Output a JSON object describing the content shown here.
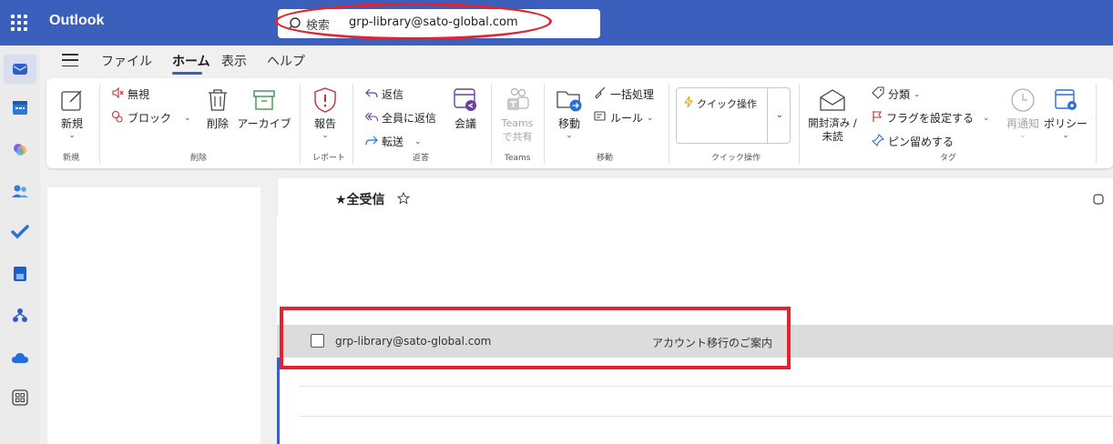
{
  "app": {
    "name": "Outlook"
  },
  "search": {
    "label": "検索",
    "value": "grp-library@sato-global.com"
  },
  "tabs": [
    {
      "label": "ファイル"
    },
    {
      "label": "ホーム"
    },
    {
      "label": "表示"
    },
    {
      "label": "ヘルプ"
    }
  ],
  "ribbon": {
    "new": {
      "label": "新規",
      "group": "新規"
    },
    "delete": {
      "ignore": "無視",
      "block": "ブロック",
      "delete": "削除",
      "archive": "アーカイブ",
      "group": "削除"
    },
    "report": {
      "label": "報告",
      "group": "レポート"
    },
    "respond": {
      "reply": "返信",
      "reply_all": "全員に返信",
      "forward": "転送",
      "meeting": "会議",
      "group": "返答"
    },
    "teams": {
      "label_line1": "Teams",
      "label_line2": "で共有",
      "group": "Teams"
    },
    "move": {
      "move": "移動",
      "sweep": "一括処理",
      "rules": "ルール",
      "group": "移動"
    },
    "quick_steps": {
      "label": "クイック操作",
      "group": "クイック操作"
    },
    "tags": {
      "read_line1": "開封済み /",
      "read_line2": "未読",
      "categorize": "分類",
      "flag": "フラグを設定する",
      "pin": "ピン留めする",
      "group": "タグ"
    },
    "snooze": {
      "label": "再通知"
    },
    "policy": {
      "label": "ポリシー"
    }
  },
  "mail_list": {
    "title": "★全受信",
    "messages": [
      {
        "from": "grp-library@sato-global.com",
        "subject": "アカウント移行のご案内"
      }
    ]
  },
  "colors": {
    "accent": "#3a5fbc",
    "highlight": "#e3232f"
  }
}
